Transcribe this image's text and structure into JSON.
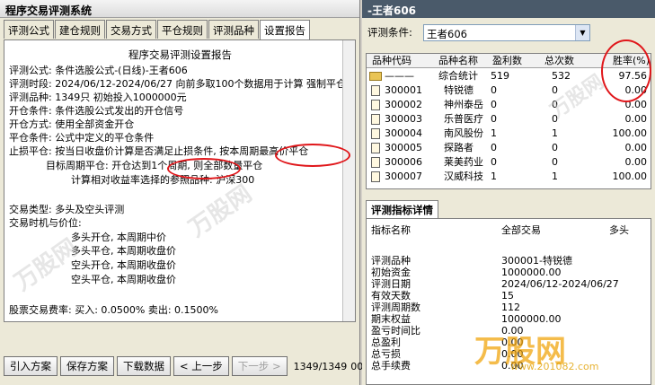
{
  "left": {
    "title": "程序交易评测系统",
    "tabs": [
      "评测公式",
      "建仓规则",
      "交易方式",
      "平仓规则",
      "评测品种",
      "设置报告"
    ],
    "active_tab": 5,
    "report_title": "程序交易评测设置报告",
    "lines": [
      "评测公式: 条件选股公式-(日线)-王者606",
      "评测时段: 2024/06/12-2024/06/27 向前多取100个数据用于计算 强制平仓",
      "评测品种: 1349只 初始投入1000000元",
      "开仓条件: 条件选股公式发出的开仓信号",
      "开仓方式: 使用全部资金开仓",
      "平仓条件: 公式中定义的平仓条件",
      "止损平仓: 按当日收盘价计算是否满足止损条件, 按本周期最高价平仓",
      "目标周期平仓: 开仓达到1个周期, 则全部数量平仓",
      "计算相对收益率选择的参照品种: 沪深300",
      "交易类型: 多头及空头评测",
      "交易时机与价位:",
      "多头开仓, 本周期中价",
      "多头平仓, 本周期收盘价",
      "空头开仓, 本周期收盘价",
      "空头平仓, 本周期收盘价",
      "股票交易费率: 买入: 0.0500%  卖出: 0.1500%"
    ],
    "buttons": [
      "引入方案",
      "保存方案",
      "下载数据",
      "< 上一步",
      "下一步 >"
    ],
    "counter": "1349/1349",
    "counter_val": "00"
  },
  "right": {
    "title": "-王者606",
    "cond_label": "评测条件:",
    "cond_value": "王者606",
    "columns": [
      "品种代码",
      "品种名称",
      "盈利数",
      "总次数",
      "胜率(%)"
    ],
    "rows": [
      {
        "code": "———",
        "name": "综合统计",
        "win": "519",
        "total": "532",
        "rate": "97.56"
      },
      {
        "code": "300001",
        "name": "特锐德",
        "win": "0",
        "total": "0",
        "rate": "0.00"
      },
      {
        "code": "300002",
        "name": "神州泰岳",
        "win": "0",
        "total": "0",
        "rate": "0.00"
      },
      {
        "code": "300003",
        "name": "乐普医疗",
        "win": "0",
        "total": "0",
        "rate": "0.00"
      },
      {
        "code": "300004",
        "name": "南风股份",
        "win": "1",
        "total": "1",
        "rate": "100.00"
      },
      {
        "code": "300005",
        "name": "探路者",
        "win": "0",
        "total": "0",
        "rate": "0.00"
      },
      {
        "code": "300006",
        "name": "莱美药业",
        "win": "0",
        "total": "0",
        "rate": "0.00"
      },
      {
        "code": "300007",
        "name": "汉威科技",
        "win": "1",
        "total": "1",
        "rate": "100.00"
      }
    ],
    "detail_tab": "评测指标详情",
    "detail_headers": [
      "指标名称",
      "全部交易",
      "多头"
    ],
    "detail_rows": [
      {
        "k": "评测品种",
        "v": "300001-特锐德"
      },
      {
        "k": "初始资金",
        "v": "1000000.00"
      },
      {
        "k": "评测日期",
        "v": "2024/06/12-2024/06/27"
      },
      {
        "k": "有效天数",
        "v": "15"
      },
      {
        "k": "评测周期数",
        "v": "112"
      },
      {
        "k": "期末权益",
        "v": "1000000.00"
      },
      {
        "k": "盈亏时间比",
        "v": "0.00"
      },
      {
        "k": "总盈利",
        "v": "0.00"
      },
      {
        "k": "总亏损",
        "v": "0.00"
      },
      {
        "k": "总手续费",
        "v": "0.00"
      }
    ],
    "watermark": "万股网",
    "watermark_url": "www.201082.com"
  }
}
